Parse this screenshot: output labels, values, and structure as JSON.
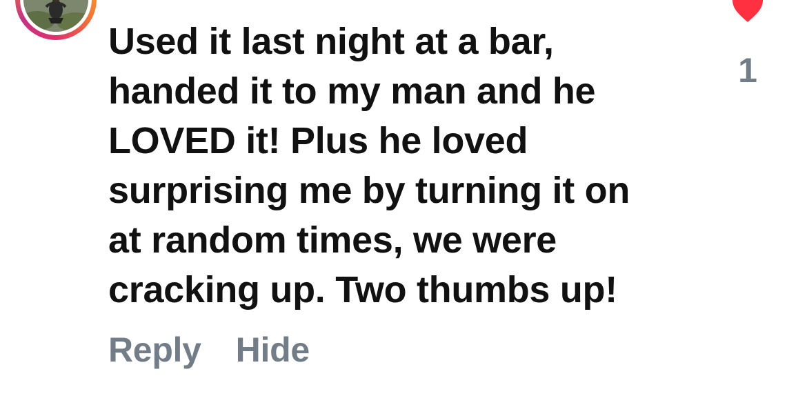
{
  "comment": {
    "text": "Used it last night at a bar,\nhanded it to my man and he\nLOVED it! Plus he loved\nsurprising me by turning it on\nat random times, we were\ncracking up. Two thumbs up!",
    "like_count": "1",
    "liked": true,
    "avatar_icon": "user-avatar-photo",
    "like_icon": "heart-icon"
  },
  "actions": {
    "reply_label": "Reply",
    "hide_label": "Hide"
  },
  "colors": {
    "text": "#111111",
    "muted": "#737d88",
    "heart": "#ff3040",
    "story_ring": [
      "#fdc830",
      "#f37335",
      "#e1306c",
      "#c13584"
    ]
  }
}
